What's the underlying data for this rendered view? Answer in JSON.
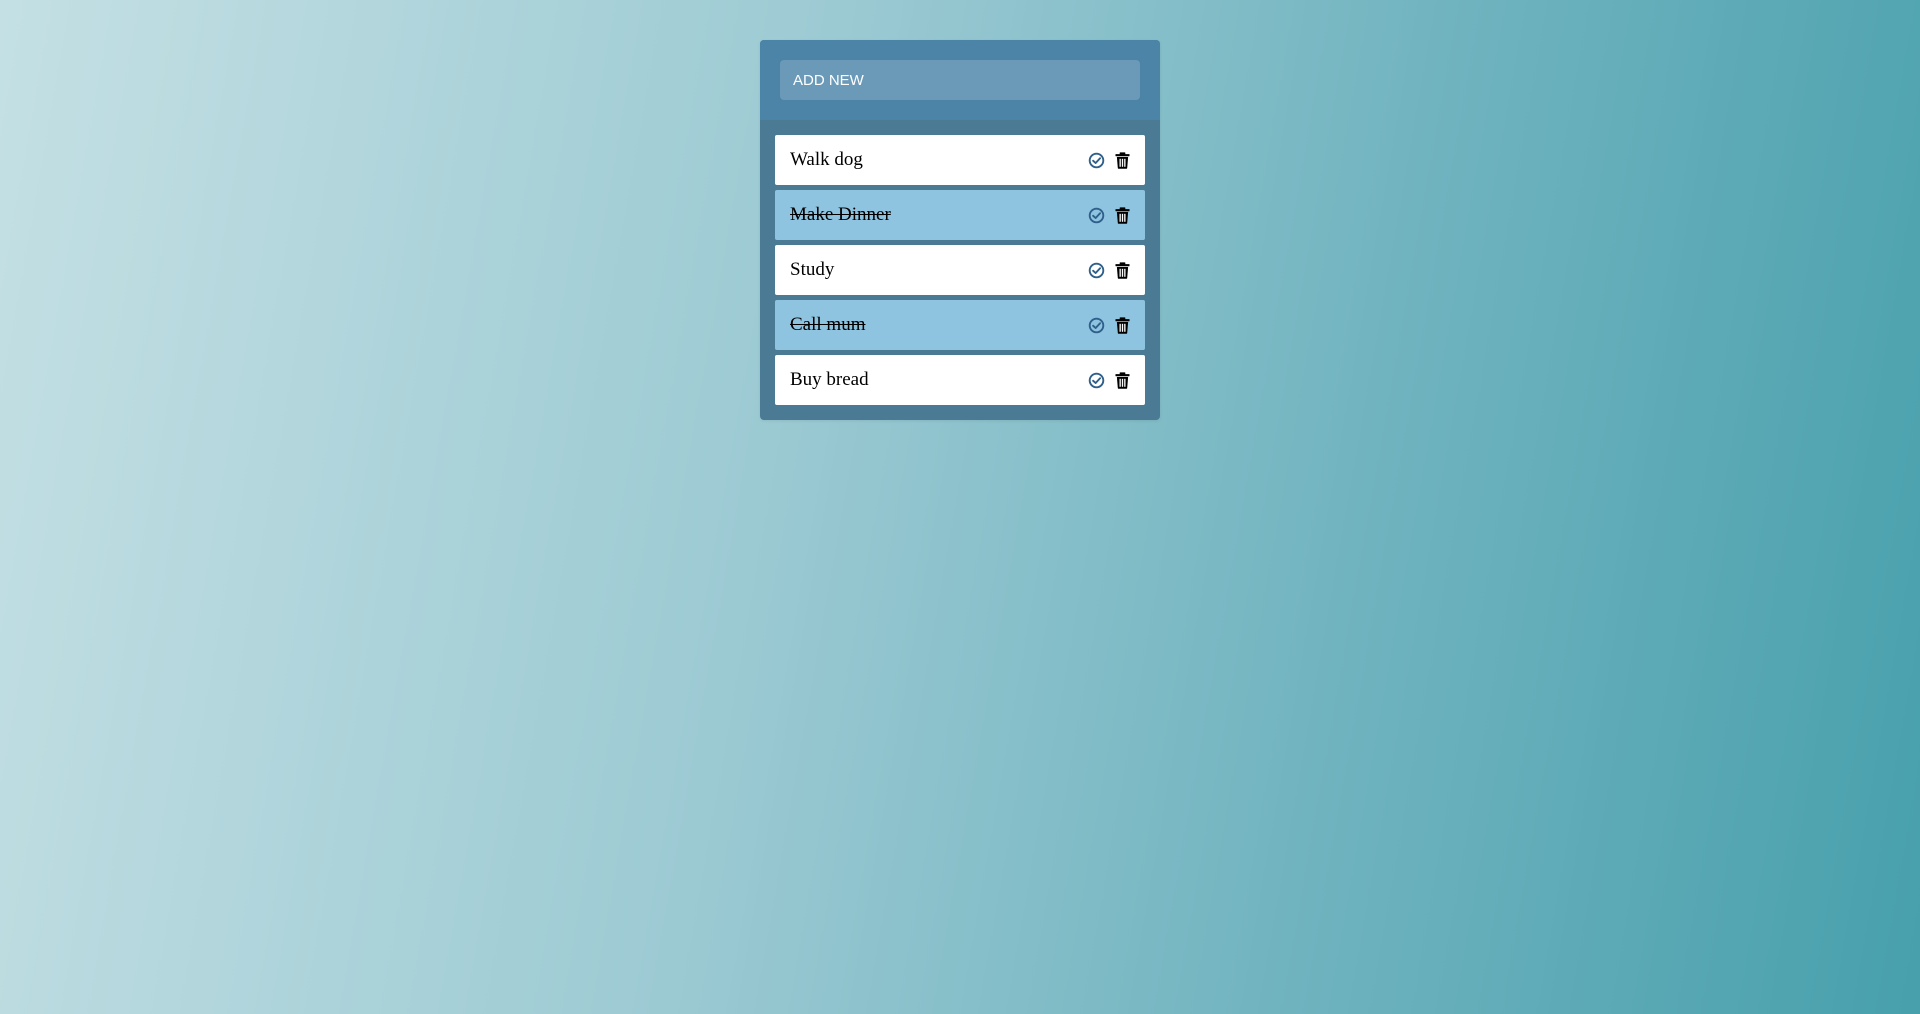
{
  "add_new": {
    "placeholder": "ADD NEW"
  },
  "colors": {
    "panel": "#4b7b94",
    "header": "#4c84a8",
    "input": "#6b9ab9",
    "item": "#ffffff",
    "item_done": "#8ec4e0",
    "check_icon": "#2f5f8a",
    "trash_icon": "#000000"
  },
  "todos": [
    {
      "text": "Walk dog",
      "done": false,
      "complete_icon": "check-circle-icon",
      "delete_icon": "trash-icon"
    },
    {
      "text": "Make Dinner",
      "done": true,
      "complete_icon": "check-circle-icon",
      "delete_icon": "trash-icon"
    },
    {
      "text": "Study",
      "done": false,
      "complete_icon": "check-circle-icon",
      "delete_icon": "trash-icon"
    },
    {
      "text": "Call mum",
      "done": true,
      "complete_icon": "check-circle-icon",
      "delete_icon": "trash-icon"
    },
    {
      "text": "Buy bread",
      "done": false,
      "complete_icon": "check-circle-icon",
      "delete_icon": "trash-icon"
    }
  ]
}
